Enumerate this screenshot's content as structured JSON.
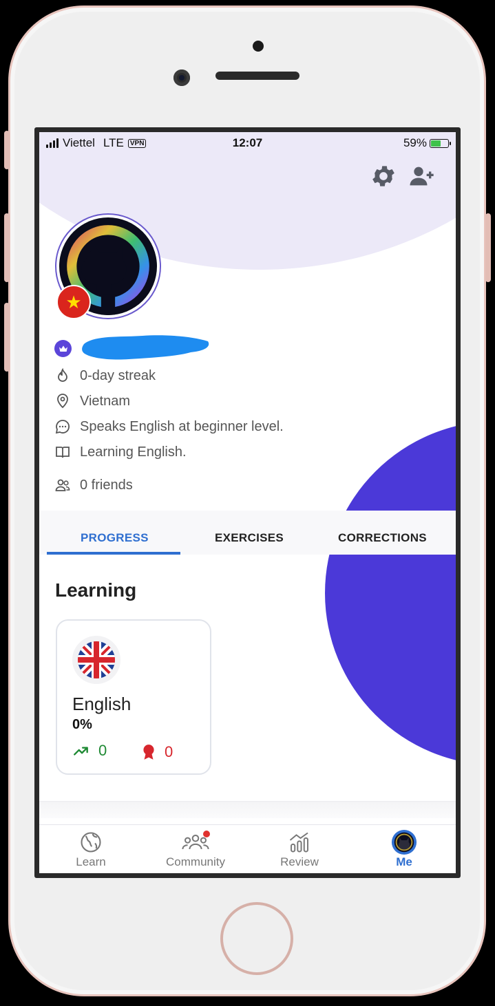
{
  "status_bar": {
    "carrier": "Viettel",
    "network": "LTE",
    "vpn": "VPN",
    "time": "12:07",
    "battery": "59%",
    "battery_level": 0.59
  },
  "header": {
    "settings_icon": "gear-icon",
    "add_friend_icon": "add-user-icon"
  },
  "profile": {
    "country_flag": "vietnam-flag",
    "streak": "0-day streak",
    "location": "Vietnam",
    "speaks": "Speaks English at beginner level.",
    "learning": "Learning English.",
    "friends": "0 friends"
  },
  "tabs": [
    {
      "label": "PROGRESS",
      "active": true
    },
    {
      "label": "EXERCISES",
      "active": false
    },
    {
      "label": "CORRECTIONS",
      "active": false
    }
  ],
  "learning": {
    "title": "Learning",
    "card": {
      "flag": "uk-flag",
      "language": "English",
      "percent": "0%",
      "progress_count": "0",
      "awards_count": "0",
      "colors": {
        "progress": "#1f8a34",
        "awards": "#d7262d"
      }
    }
  },
  "tab_bar": [
    {
      "label": "Learn",
      "icon": "globe-icon",
      "active": false
    },
    {
      "label": "Community",
      "icon": "people-icon",
      "active": false,
      "notification": true
    },
    {
      "label": "Review",
      "icon": "bar-chart-icon",
      "active": false
    },
    {
      "label": "Me",
      "icon": "avatar-icon",
      "active": true
    }
  ],
  "colors": {
    "accent": "#2f6fd0",
    "brand_purple": "#4b39d8",
    "header_bg": "#ece9f8"
  }
}
